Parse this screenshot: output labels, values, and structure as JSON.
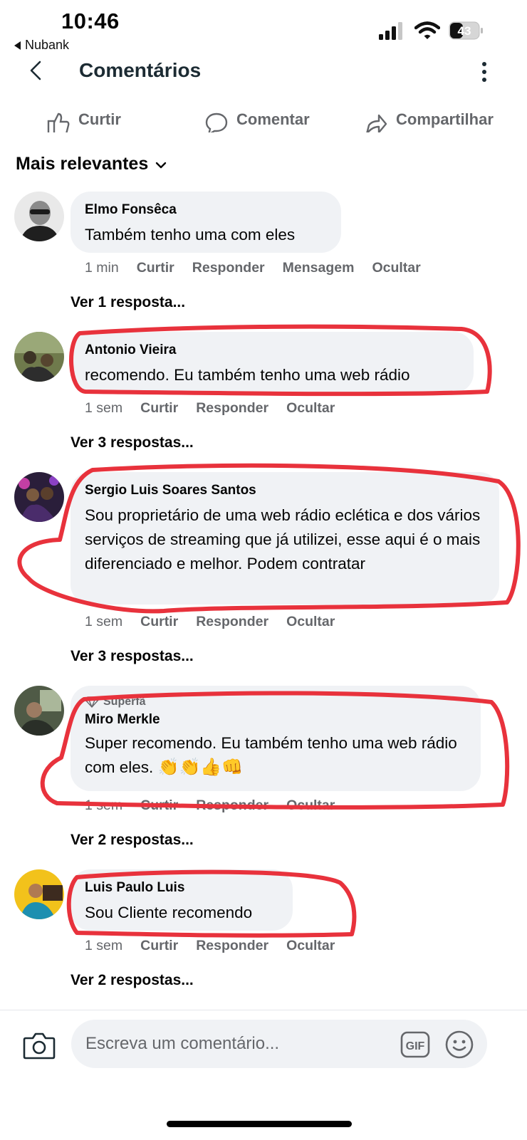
{
  "status_bar": {
    "time": "10:46",
    "back_app": "Nubank",
    "battery": "43"
  },
  "header": {
    "title": "Comentários"
  },
  "actions": {
    "like": "Curtir",
    "comment": "Comentar",
    "share": "Compartilhar"
  },
  "filter": {
    "label": "Mais relevantes"
  },
  "comments": [
    {
      "author": "Elmo Fonsêca",
      "text": "Também tenho uma com eles",
      "time": "1 min",
      "actions": [
        "Curtir",
        "Responder",
        "Mensagem",
        "Ocultar"
      ],
      "replies": "Ver 1 resposta..."
    },
    {
      "author": "Antonio Vieira",
      "text": "recomendo. Eu também tenho uma web rádio",
      "time": "1 sem",
      "actions": [
        "Curtir",
        "Responder",
        "Ocultar"
      ],
      "replies": "Ver 3 respostas..."
    },
    {
      "author": "Sergio Luis Soares Santos",
      "text": "Sou proprietário de uma web rádio eclética e dos vários serviços de streaming que já utilizei, esse aqui é o mais diferenciado e melhor. Podem contratar",
      "time": "1 sem",
      "actions": [
        "Curtir",
        "Responder",
        "Ocultar"
      ],
      "replies": "Ver 3 respostas..."
    },
    {
      "badge": "Superfã",
      "author": "Miro Merkle",
      "text": "Super recomendo. Eu também tenho uma web rádio com eles.",
      "emojis": "👏👏👍👊",
      "time": "1 sem",
      "actions": [
        "Curtir",
        "Responder",
        "Ocultar"
      ],
      "replies": "Ver 2 respostas..."
    },
    {
      "author": "Luis Paulo Luis",
      "text": "Sou Cliente recomendo",
      "time": "1 sem",
      "actions": [
        "Curtir",
        "Responder",
        "Ocultar"
      ],
      "replies": "Ver 2 respostas..."
    }
  ],
  "composer": {
    "placeholder": "Escreva um comentário...",
    "gif_label": "GIF"
  },
  "colors": {
    "annotation": "#e8323c",
    "bubble": "#f0f2f5",
    "secondary_text": "#65676b"
  }
}
